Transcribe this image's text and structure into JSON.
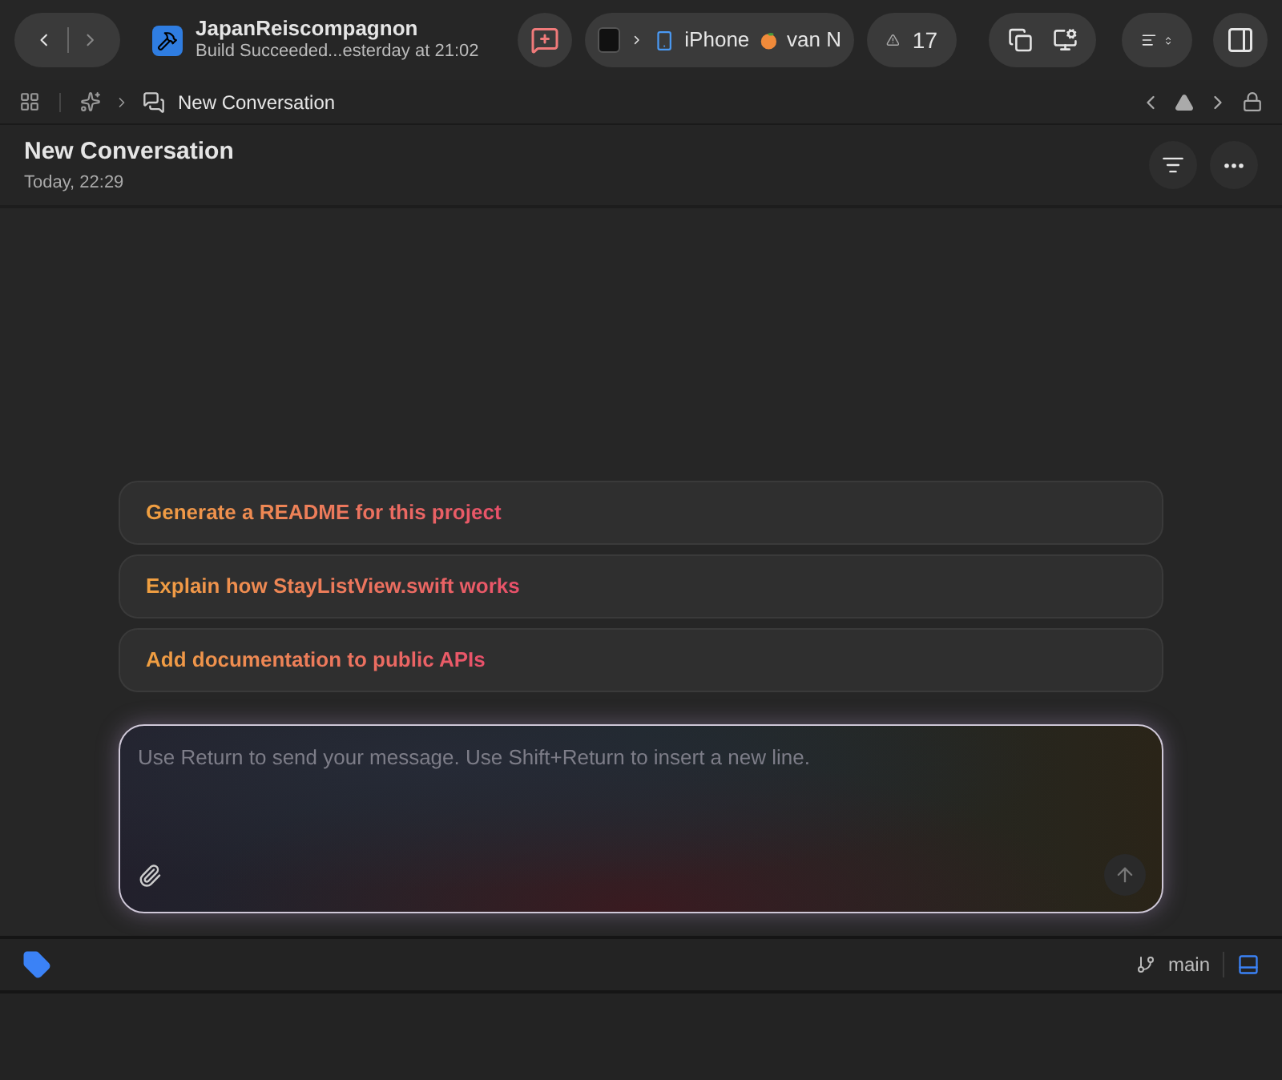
{
  "toolbar": {
    "project_name": "JapanReiscompagnon",
    "build_status": "Build Succeeded...esterday at 21:02",
    "device_name_start": "iPhone",
    "device_name_end": "van N",
    "warning_count": "17"
  },
  "breadcrumb": {
    "label": "New Conversation"
  },
  "header": {
    "title": "New Conversation",
    "time": "Today, 22:29"
  },
  "suggestions": [
    "Generate a README for this project",
    "Explain how StayListView.swift works",
    "Add documentation to public APIs"
  ],
  "composer": {
    "placeholder": "Use Return to send your message. Use Shift+Return to insert a new line."
  },
  "status_bar": {
    "branch": "main"
  }
}
